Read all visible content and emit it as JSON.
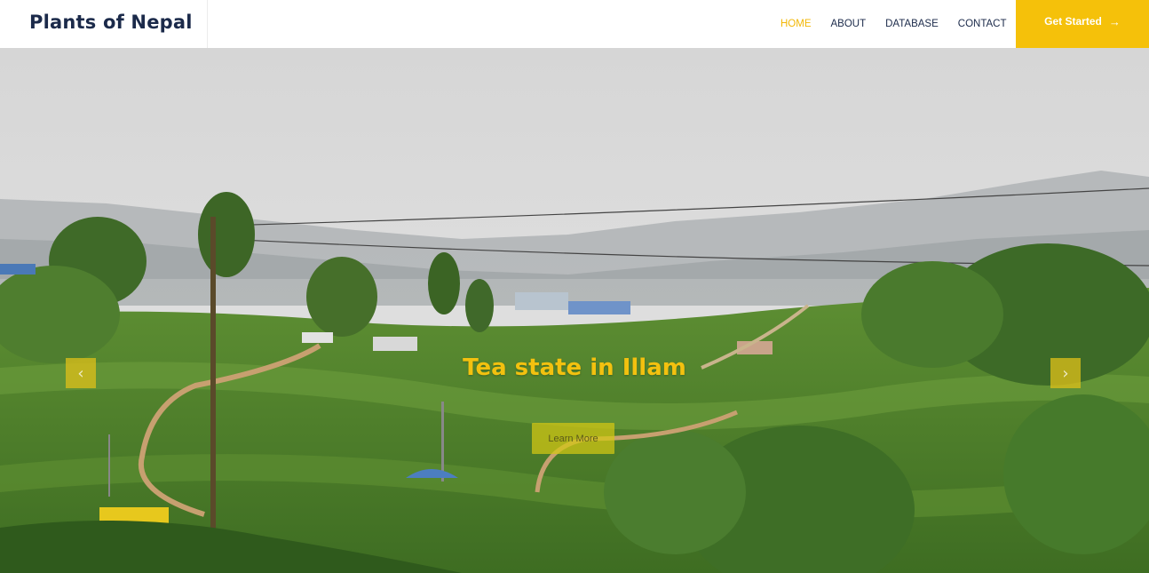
{
  "header": {
    "brand": "Plants of Nepal",
    "nav": [
      {
        "label": "HOME",
        "active": true
      },
      {
        "label": "ABOUT",
        "active": false
      },
      {
        "label": "DATABASE",
        "active": false
      },
      {
        "label": "CONTACT",
        "active": false
      }
    ],
    "cta_label": "Get Started",
    "cta_icon": "arrow-right-icon"
  },
  "hero": {
    "title": "Tea state in Illam",
    "button_label": "Learn More",
    "prev_icon": "chevron-left-icon",
    "next_icon": "chevron-right-icon"
  },
  "colors": {
    "accent": "#f5c10a",
    "brand_text": "#1b2a4a",
    "nav_active": "#f2b705"
  }
}
